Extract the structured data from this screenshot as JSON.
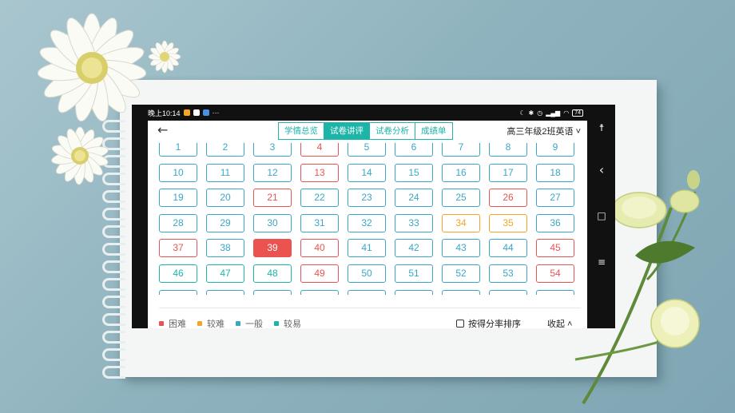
{
  "statusbar": {
    "time": "晚上10:14",
    "dots": "···",
    "battery": "74"
  },
  "nav": {
    "tabs": [
      {
        "label": "学情总览",
        "active": false
      },
      {
        "label": "试卷讲评",
        "active": true
      },
      {
        "label": "试卷分析",
        "active": false
      },
      {
        "label": "成绩单",
        "active": false
      }
    ],
    "class_selector": "高三年级2班英语 ˅"
  },
  "colors": {
    "hard": "#e85454",
    "medium": "#f2a623",
    "normal": "#3aa7c6",
    "easy": "#1cb5a8",
    "selected": "#ea5350"
  },
  "questions": [
    {
      "n": "1",
      "level": "normal"
    },
    {
      "n": "2",
      "level": "normal"
    },
    {
      "n": "3",
      "level": "normal"
    },
    {
      "n": "4",
      "level": "hard"
    },
    {
      "n": "5",
      "level": "normal"
    },
    {
      "n": "6",
      "level": "normal"
    },
    {
      "n": "7",
      "level": "normal"
    },
    {
      "n": "8",
      "level": "normal"
    },
    {
      "n": "9",
      "level": "normal"
    },
    {
      "n": "10",
      "level": "normal"
    },
    {
      "n": "11",
      "level": "normal"
    },
    {
      "n": "12",
      "level": "normal"
    },
    {
      "n": "13",
      "level": "hard"
    },
    {
      "n": "14",
      "level": "normal"
    },
    {
      "n": "15",
      "level": "normal"
    },
    {
      "n": "16",
      "level": "normal"
    },
    {
      "n": "17",
      "level": "normal"
    },
    {
      "n": "18",
      "level": "normal"
    },
    {
      "n": "19",
      "level": "normal"
    },
    {
      "n": "20",
      "level": "normal"
    },
    {
      "n": "21",
      "level": "hard"
    },
    {
      "n": "22",
      "level": "normal"
    },
    {
      "n": "23",
      "level": "normal"
    },
    {
      "n": "24",
      "level": "normal"
    },
    {
      "n": "25",
      "level": "normal"
    },
    {
      "n": "26",
      "level": "hard"
    },
    {
      "n": "27",
      "level": "normal"
    },
    {
      "n": "28",
      "level": "normal"
    },
    {
      "n": "29",
      "level": "normal"
    },
    {
      "n": "30",
      "level": "normal"
    },
    {
      "n": "31",
      "level": "normal"
    },
    {
      "n": "32",
      "level": "normal"
    },
    {
      "n": "33",
      "level": "normal"
    },
    {
      "n": "34",
      "level": "medium"
    },
    {
      "n": "35",
      "level": "medium"
    },
    {
      "n": "36",
      "level": "normal"
    },
    {
      "n": "37",
      "level": "hard"
    },
    {
      "n": "38",
      "level": "normal"
    },
    {
      "n": "39",
      "level": "selected"
    },
    {
      "n": "40",
      "level": "hard"
    },
    {
      "n": "41",
      "level": "normal"
    },
    {
      "n": "42",
      "level": "normal"
    },
    {
      "n": "43",
      "level": "normal"
    },
    {
      "n": "44",
      "level": "normal"
    },
    {
      "n": "45",
      "level": "hard"
    },
    {
      "n": "46",
      "level": "easy"
    },
    {
      "n": "47",
      "level": "easy"
    },
    {
      "n": "48",
      "level": "easy"
    },
    {
      "n": "49",
      "level": "hard"
    },
    {
      "n": "50",
      "level": "normal"
    },
    {
      "n": "51",
      "level": "normal"
    },
    {
      "n": "52",
      "level": "normal"
    },
    {
      "n": "53",
      "level": "normal"
    },
    {
      "n": "54",
      "level": "hard"
    }
  ],
  "legend": [
    {
      "label": "困难",
      "level": "hard"
    },
    {
      "label": "较难",
      "level": "medium"
    },
    {
      "label": "一般",
      "level": "normal"
    },
    {
      "label": "较易",
      "level": "easy"
    }
  ],
  "footer": {
    "sort_label": "按得分率排序",
    "collapse_label": "收起 ˄"
  },
  "side_nav": {
    "accessibility": "☨",
    "back": "‹",
    "home": "□",
    "menu": "≡"
  }
}
